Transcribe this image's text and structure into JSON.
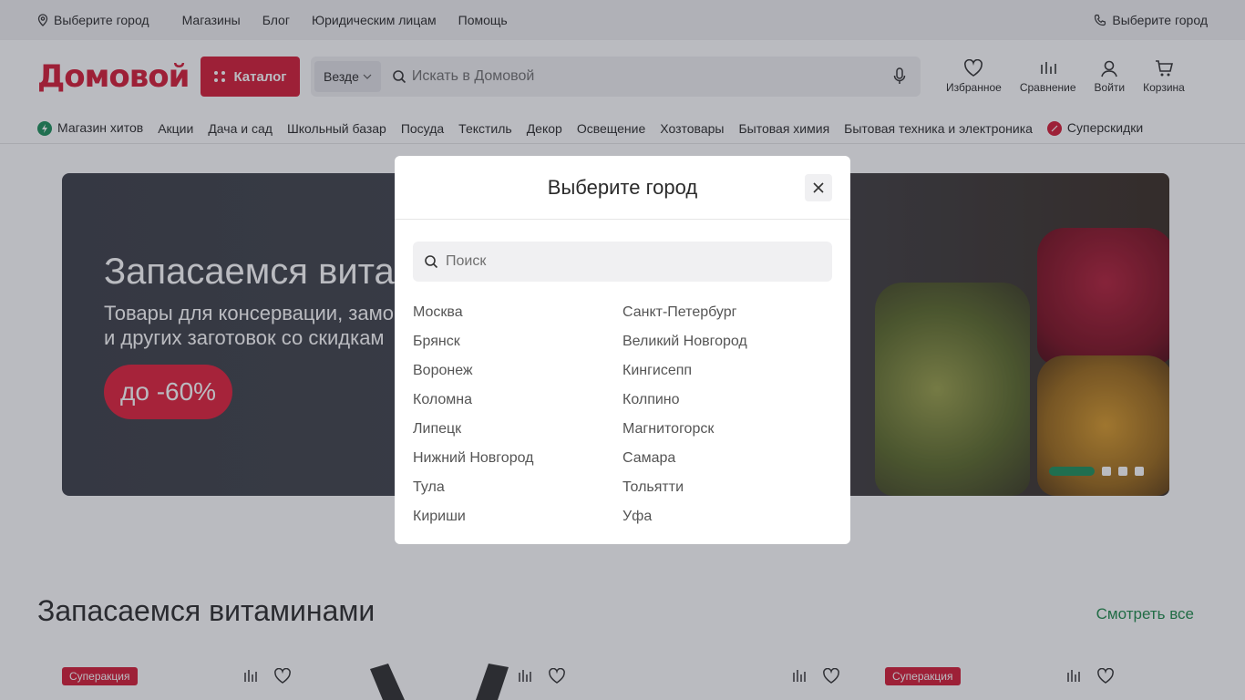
{
  "topbar": {
    "location_label": "Выберите город",
    "links": [
      "Магазины",
      "Блог",
      "Юридическим лицам",
      "Помощь"
    ],
    "phone_label": "Выберите город"
  },
  "header": {
    "logo_text": "Домовой",
    "catalog_label": "Каталог",
    "search_scope": "Везде",
    "search_placeholder": "Искать в Домовой",
    "actions": {
      "favorites": "Избранное",
      "compare": "Сравнение",
      "login": "Войти",
      "cart": "Корзина"
    }
  },
  "categories": [
    "Магазин хитов",
    "Акции",
    "Дача и сад",
    "Школьный базар",
    "Посуда",
    "Текстиль",
    "Декор",
    "Освещение",
    "Хозтовары",
    "Бытовая химия",
    "Бытовая техника и электроника",
    "Суперскидки"
  ],
  "banner": {
    "title": "Запасаемся вита",
    "subtitle_line1": "Товары для консервации, замо",
    "subtitle_line2": "и других заготовок со скидкам",
    "promo": "до -60%",
    "slides_total": 4,
    "active_slide": 1
  },
  "section": {
    "title": "Запасаемся витаминами",
    "see_all": "Смотреть все",
    "badge": "Суперакция"
  },
  "modal": {
    "title": "Выберите город",
    "search_placeholder": "Поиск",
    "cities_left": [
      "Москва",
      "Брянск",
      "Воронеж",
      "Коломна",
      "Липецк",
      "Нижний Новгород",
      "Тула",
      "Кириши"
    ],
    "cities_right": [
      "Санкт-Петербург",
      "Великий Новгород",
      "Кингисепп",
      "Колпино",
      "Магнитогорск",
      "Самара",
      "Тольятти",
      "Уфа"
    ]
  },
  "colors": {
    "brand": "#d41b35",
    "accent_green": "#1c8f5a",
    "overlay": "rgba(40,44,60,0.32)"
  }
}
